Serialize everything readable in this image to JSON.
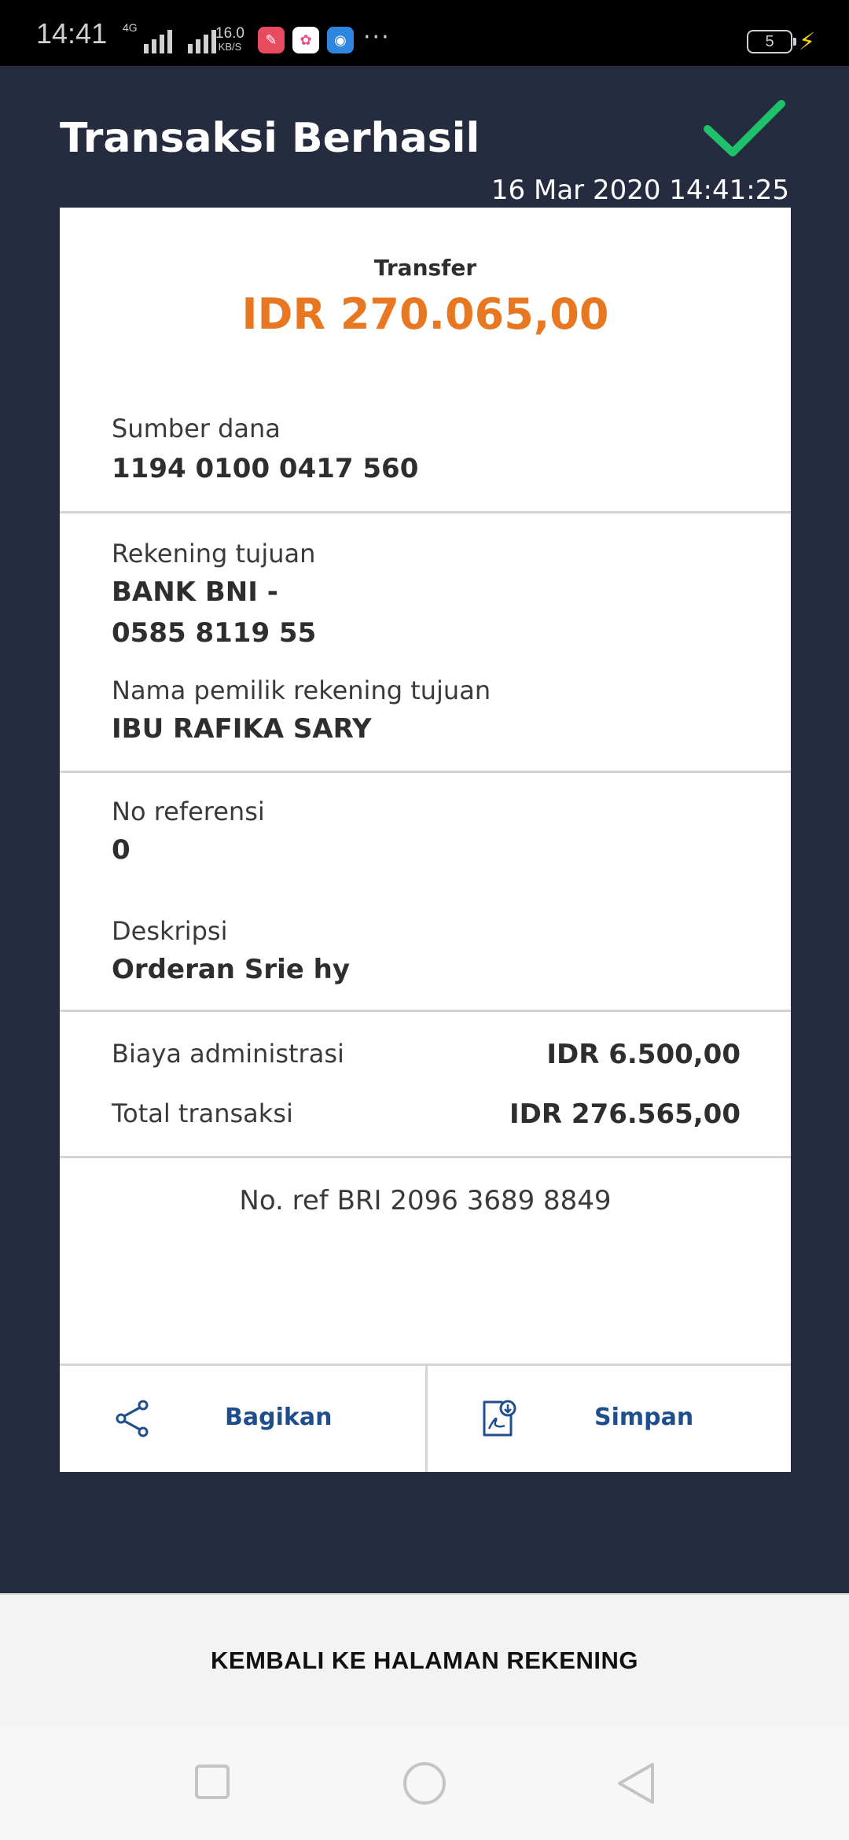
{
  "status_bar": {
    "time": "14:41",
    "network": "4G",
    "speed_value": "16.0",
    "speed_unit": "KB/S",
    "battery": "5",
    "more": "···"
  },
  "header": {
    "title": "Transaksi Berhasil",
    "datetime": "16 Mar 2020 14:41:25"
  },
  "transaction": {
    "type_label": "Transfer",
    "amount": "IDR 270.065,00"
  },
  "details": {
    "source_label": "Sumber dana",
    "source_value": "1194 0100 0417 560",
    "dest_label": "Rekening tujuan",
    "dest_bank": "BANK BNI -",
    "dest_account": "0585 8119 55",
    "owner_label": "Nama pemilik rekening tujuan",
    "owner_value": "IBU RAFIKA  SARY",
    "ref_label": "No referensi",
    "ref_value": "0",
    "desc_label": "Deskripsi",
    "desc_value": "Orderan Srie hy"
  },
  "fees": {
    "admin_label": "Biaya administrasi",
    "admin_value": "IDR 6.500,00",
    "total_label": "Total transaksi",
    "total_value": "IDR 276.565,00"
  },
  "bri_ref": "No. ref BRI 2096 3689 8849",
  "actions": {
    "share_label": "Bagikan",
    "save_label": "Simpan"
  },
  "back_button": "KEMBALI KE HALAMAN REKENING",
  "colors": {
    "background": "#262c40",
    "amount": "#e87722",
    "success": "#1fc26b",
    "action_text": "#1f4e8c"
  }
}
